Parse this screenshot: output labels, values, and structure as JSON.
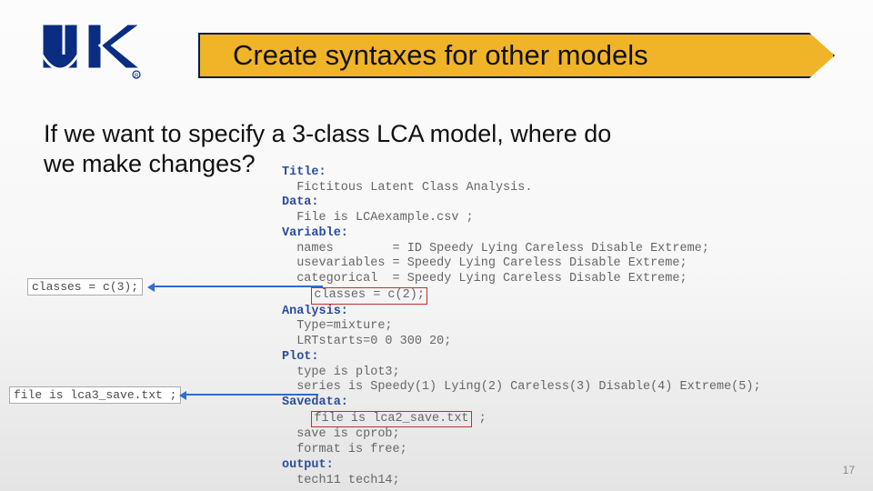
{
  "title": "Create syntaxes for other models",
  "question": "If we want to specify a 3-class LCA model, where do we make changes?",
  "page_number": "17",
  "annotations": {
    "classes_change": "classes = c(3);",
    "file_change": "file is lca3_save.txt ;"
  },
  "code": {
    "title": "Title:",
    "title_line": "  Fictitous Latent Class Analysis.",
    "data": "Data:",
    "data_line": "  File is LCAexample.csv ;",
    "variable": "Variable:",
    "names": "  names        = ID Speedy Lying Careless Disable Extreme;",
    "usevars": "  usevariables = Speedy Lying Careless Disable Extreme;",
    "categorical": "  categorical  = Speedy Lying Careless Disable Extreme;",
    "classes_pre": "    ",
    "classes": "classes = c(2);",
    "analysis": "Analysis:",
    "analysis_l1": "  Type=mixture;",
    "analysis_l2": "  LRTstarts=0 0 300 20;",
    "plot": "Plot:",
    "plot_l1": "  type is plot3;",
    "plot_l2": "  series is Speedy(1) Lying(2) Careless(3) Disable(4) Extreme(5);",
    "savedata": "Savedata:",
    "file_pre": "    ",
    "file_boxed": "file is lca2_save.txt",
    "file_post": " ;",
    "save_l2": "  save is cprob;",
    "save_l3": "  format is free;",
    "output": "output:",
    "output_l1": "  tech11 tech14;"
  }
}
